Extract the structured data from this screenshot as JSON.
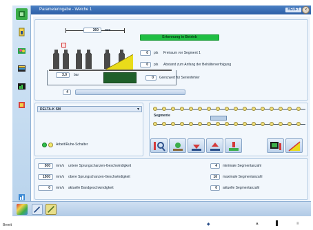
{
  "window": {
    "title": "Parameteringabe - Weiche 1",
    "brand": "HEUFT",
    "close_symbol": "×"
  },
  "left_toolbar": {
    "icons": [
      "home-icon",
      "info-icon",
      "flower-icon",
      "list-icon",
      "chart-icon",
      "settings-icon",
      "diagnostic-icon"
    ]
  },
  "upper": {
    "spacing_value": "360",
    "spacing_unit": "mm",
    "green_button": "Erkennung in Betrieb",
    "rows": [
      {
        "value": "0",
        "unit": "pls",
        "label": "Freiraum vor Segment 1"
      },
      {
        "value": "0",
        "unit": "pls",
        "label": "Abstand zum Anfang der Behälterverfolgung"
      }
    ],
    "pressure_value": "3.0",
    "pressure_unit": "bar",
    "limit_value": "0",
    "limit_label": "Grenzwert für Serienfehler",
    "slider_value": "4",
    "colors": {
      "green": "#1fbe43",
      "yellow": "#e9dc1a",
      "dark_green": "#1f5f2a",
      "red": "#d43a3a"
    }
  },
  "middle": {
    "select_value": "DELTA-K SM",
    "switch_label": "Arbeit/Ruhe-Schalter",
    "segments_label": "Segmente"
  },
  "bottom_rows": {
    "left": [
      {
        "value": "500",
        "unit": "mm/s",
        "label": "untere Sprungschanzen-Geschwindigkeit"
      },
      {
        "value": "1500",
        "unit": "mm/s",
        "label": "obere Sprungschanzen-Geschwindigkeit"
      },
      {
        "value": "0",
        "unit": "mm/s",
        "label": "aktuelle Bandgeschwindigkeit"
      }
    ],
    "right": [
      {
        "value": "4",
        "label": "minimale Segmentanzahl"
      },
      {
        "value": "16",
        "label": "maximale Segmentanzahl"
      },
      {
        "value": "0",
        "label": "aktuelle Segmentanzahl"
      }
    ]
  },
  "statusbar": {
    "text": "Bereit"
  }
}
